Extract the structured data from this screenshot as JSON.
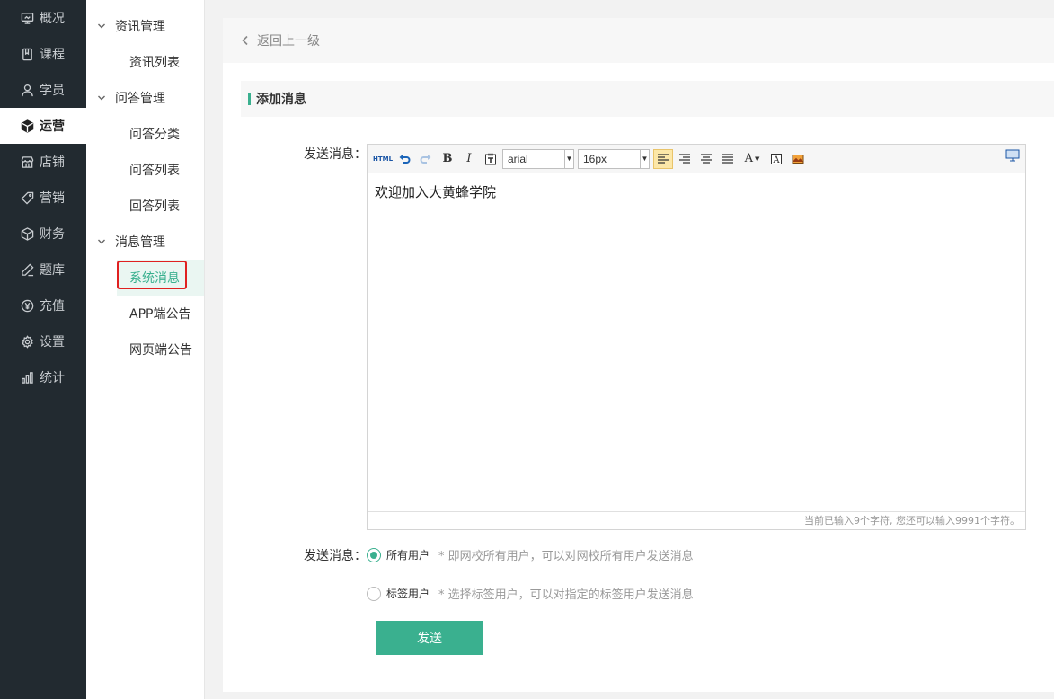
{
  "nav": {
    "items": [
      {
        "label": "概况",
        "icon": "monitor-icon"
      },
      {
        "label": "课程",
        "icon": "book-icon"
      },
      {
        "label": "学员",
        "icon": "user-icon"
      },
      {
        "label": "运营",
        "icon": "cube-icon",
        "active": true
      },
      {
        "label": "店铺",
        "icon": "store-icon"
      },
      {
        "label": "营销",
        "icon": "tag-icon"
      },
      {
        "label": "财务",
        "icon": "coin-box-icon"
      },
      {
        "label": "题库",
        "icon": "pen-icon"
      },
      {
        "label": "充值",
        "icon": "yen-icon"
      },
      {
        "label": "设置",
        "icon": "gear-icon"
      },
      {
        "label": "统计",
        "icon": "bar-chart-icon"
      }
    ]
  },
  "submenu": {
    "groups": [
      {
        "label": "资讯管理",
        "items": [
          "资讯列表"
        ]
      },
      {
        "label": "问答管理",
        "items": [
          "问答分类",
          "问答列表",
          "回答列表"
        ]
      },
      {
        "label": "消息管理",
        "items": [
          "系统消息",
          "APP端公告",
          "网页端公告"
        ]
      }
    ],
    "active_item": "系统消息"
  },
  "main": {
    "back_label": "返回上一级",
    "section_title": "添加消息",
    "message_label": "发送消息：",
    "editor": {
      "font_family": "arial",
      "font_size": "16px",
      "content": "欢迎加入大黄蜂学院",
      "counter": "当前已输入9个字符, 您还可以输入9991个字符。"
    },
    "recipient_label": "发送消息：",
    "options": [
      {
        "label": "所有用户",
        "hint": "* 即网校所有用户，可以对网校所有用户发送消息",
        "checked": true
      },
      {
        "label": "标签用户",
        "hint": "* 选择标签用户，可以对指定的标签用户发送消息",
        "checked": false
      }
    ],
    "send_label": "发送"
  }
}
